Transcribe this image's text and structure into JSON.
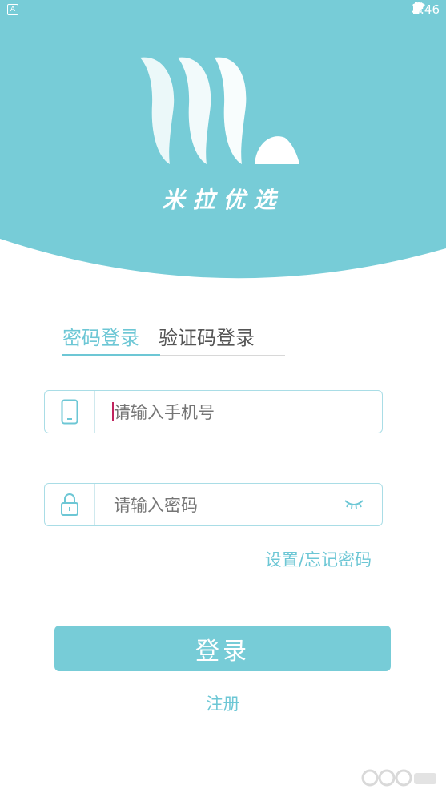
{
  "colors": {
    "accent": "#77ccd7",
    "header_bg": "#77ccd7",
    "border": "#a9dde6"
  },
  "status_bar": {
    "left_icon": "A",
    "time": "2:46"
  },
  "brand": {
    "name": "米拉优选",
    "logo": "ml-logo"
  },
  "login_tabs": [
    {
      "label": "密码登录",
      "active": true
    },
    {
      "label": "验证码登录",
      "active": false
    }
  ],
  "phone_field": {
    "icon": "phone-icon",
    "placeholder": "请输入手机号",
    "value": ""
  },
  "password_field": {
    "icon": "lock-icon",
    "placeholder": "请输入密码",
    "value": "",
    "toggle_icon": "eye-closed-icon"
  },
  "forgot_link": "设置/忘记密码",
  "login_button": "登录",
  "register_link": "注册"
}
